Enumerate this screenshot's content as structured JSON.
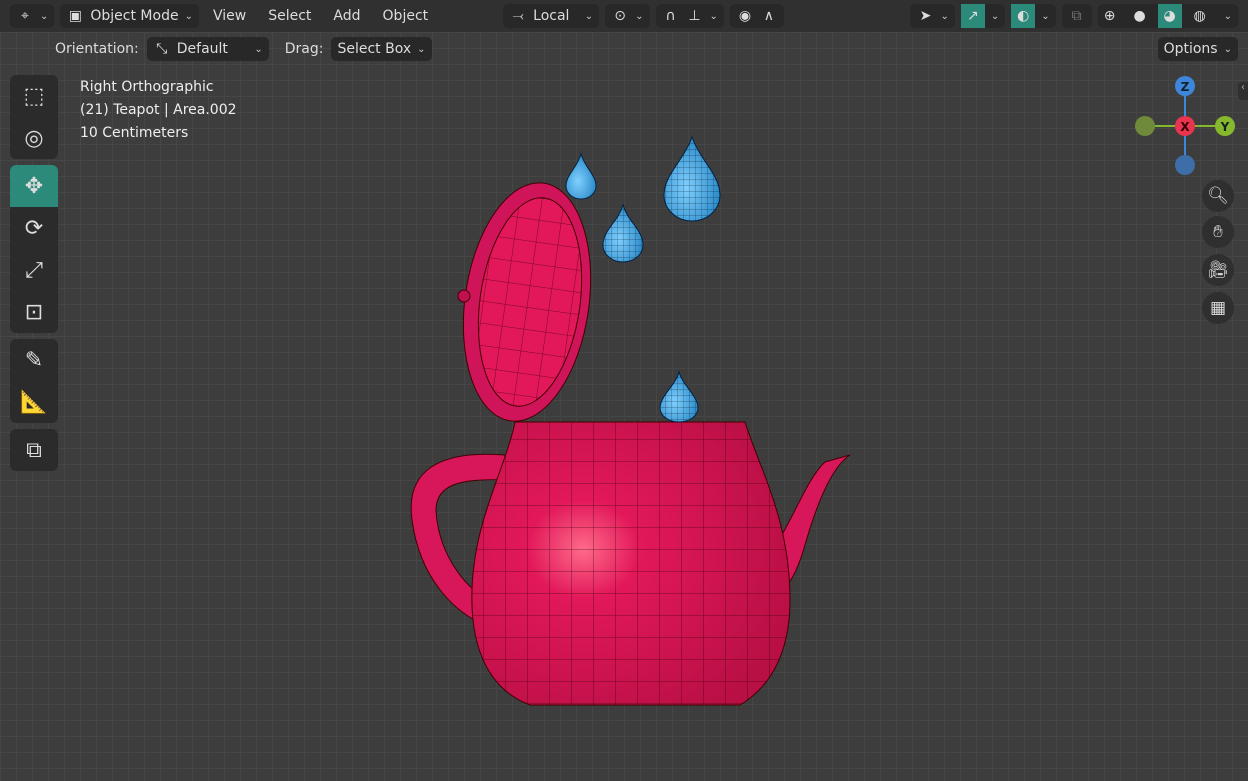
{
  "header": {
    "mode": "Object Mode",
    "menus": [
      "View",
      "Select",
      "Add",
      "Object"
    ],
    "transform_orientation": "Local"
  },
  "tool_settings": {
    "orientation_label": "Orientation:",
    "orientation_value": "Default",
    "drag_label": "Drag:",
    "drag_value": "Select Box",
    "options": "Options"
  },
  "overlay_info": {
    "view": "Right Orthographic",
    "object": "(21) Teapot | Area.002",
    "scale": "10 Centimeters"
  },
  "gizmo": {
    "z": "Z",
    "x": "X",
    "y": "Y"
  },
  "colors": {
    "accent": "#2b8a79",
    "teapot": "#e2185a",
    "drops": "#3aa3e0",
    "x_axis": "#e8344f",
    "y_axis": "#86b82e",
    "z_axis": "#3d86d9"
  }
}
